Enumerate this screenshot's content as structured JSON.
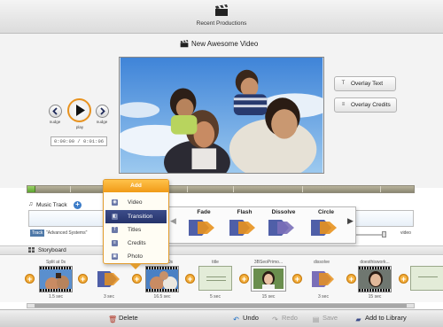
{
  "app": {
    "title": "Recent Productions",
    "icon": "clapperboard-icon"
  },
  "project": {
    "title": "New Awesome Video",
    "icon": "clapperboard-icon"
  },
  "playback": {
    "nudge_back_label": "nudge",
    "play_label": "play",
    "nudge_forward_label": "nudge",
    "time": "0:00:00 / 0:01:06",
    "progress": 0.02
  },
  "overlay_buttons": {
    "overlay_text": {
      "label": "Overlay Text",
      "icon": "text-icon",
      "glyph": "T"
    },
    "overlay_credits": {
      "label": "Overlay Credits",
      "icon": "credits-icon",
      "glyph": "≡"
    }
  },
  "music": {
    "label": "Music Track",
    "add_glyph": "+",
    "track_badge": "Track",
    "track_name": "\"Advanced Systems\"",
    "volume_label": "video",
    "volume_level": 0.96
  },
  "add_menu": {
    "header": "Add",
    "items": [
      {
        "label": "Video",
        "icon": "video-icon",
        "glyph": "◉",
        "selected": false
      },
      {
        "label": "Transition",
        "icon": "transition-icon",
        "glyph": "◧",
        "selected": true
      },
      {
        "label": "Titles",
        "icon": "titles-icon",
        "glyph": "T",
        "selected": false
      },
      {
        "label": "Credits",
        "icon": "credits-icon",
        "glyph": "≡",
        "selected": false
      },
      {
        "label": "Photo",
        "icon": "photo-icon",
        "glyph": "▣",
        "selected": false
      }
    ]
  },
  "transitions": [
    {
      "label": "Fade",
      "icon": "fade-transition-icon",
      "accent": "#e8921e"
    },
    {
      "label": "Flash",
      "icon": "flash-transition-icon",
      "accent": "#e8921e"
    },
    {
      "label": "Dissolve",
      "icon": "dissolve-transition-icon",
      "accent": "#7a6fb8"
    },
    {
      "label": "Circle",
      "icon": "circle-transition-icon",
      "accent": "#e8921e"
    }
  ],
  "storyboard": {
    "label": "Storyboard",
    "add_glyph": "+",
    "clips": [
      {
        "title": "Split at 0s",
        "duration": "1.5 sec",
        "type": "video"
      },
      {
        "title": "",
        "duration": "3 sec",
        "type": "transition"
      },
      {
        "title": "Split at 0s",
        "duration": "16.5 sec",
        "type": "video"
      },
      {
        "title": "title",
        "duration": "5 sec",
        "type": "title"
      },
      {
        "title": "3BSeoPrimo...",
        "duration": "15 sec",
        "type": "photo"
      },
      {
        "title": "dissolve",
        "duration": "3 sec",
        "type": "transition"
      },
      {
        "title": "doesthiswork...",
        "duration": "15 sec",
        "type": "photo"
      },
      {
        "title": "",
        "duration": "",
        "type": "title-partial"
      }
    ]
  },
  "toolbar": {
    "delete": {
      "label": "Delete",
      "icon": "trash-icon",
      "enabled": true
    },
    "undo": {
      "label": "Undo",
      "icon": "undo-icon",
      "enabled": true
    },
    "redo": {
      "label": "Redo",
      "icon": "redo-icon",
      "enabled": false
    },
    "save": {
      "label": "Save",
      "icon": "save-icon",
      "enabled": false
    },
    "add_to_library": {
      "label": "Add to Library",
      "icon": "library-icon",
      "enabled": true
    }
  },
  "colors": {
    "accent_orange": "#e8921e",
    "menu_selected": "#25336b",
    "timeline_progress": "#6ab23a",
    "transition_blue": "#4f5fa8"
  }
}
